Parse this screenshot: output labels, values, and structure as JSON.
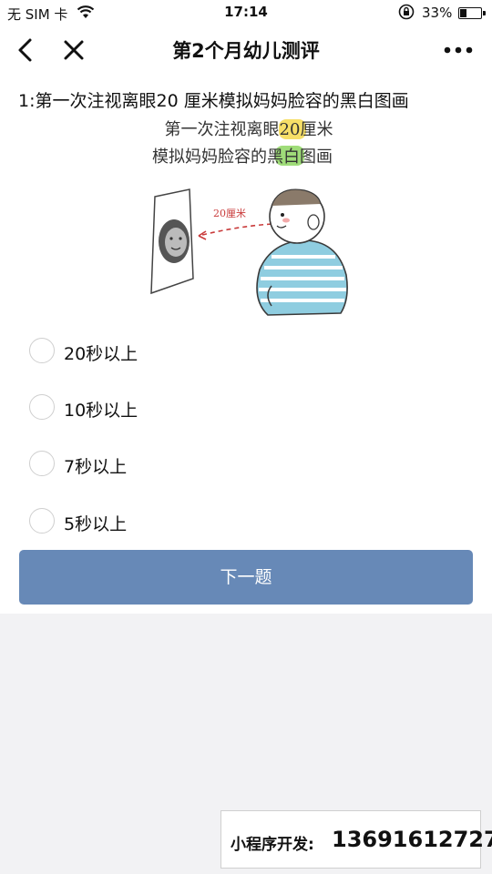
{
  "status_bar": {
    "carrier": "无 SIM 卡",
    "time": "17:14",
    "battery_percent": "33%",
    "battery_level": 0.33
  },
  "nav": {
    "title": "第2个月幼儿测评",
    "icons": [
      "back-arrow-icon",
      "close-icon",
      "more-icon"
    ]
  },
  "question": {
    "text": "1:第一次注视离眼20 厘米模拟妈妈脸容的黑白图画"
  },
  "illustration": {
    "line1": "第一次注视离眼20厘米",
    "line2": "模拟妈妈脸容的黑白图画",
    "distance_label": "20厘米",
    "highlight_colors": {
      "yellow": "#f6df68",
      "green": "#9fdc79"
    }
  },
  "options": [
    {
      "label": "20秒以上"
    },
    {
      "label": "10秒以上"
    },
    {
      "label": "7秒以上"
    },
    {
      "label": "5秒以上"
    }
  ],
  "next_button": {
    "label": "下一题",
    "color": "#6789b7"
  },
  "promo": {
    "label": "小程序开发:",
    "number": "13691612727"
  }
}
